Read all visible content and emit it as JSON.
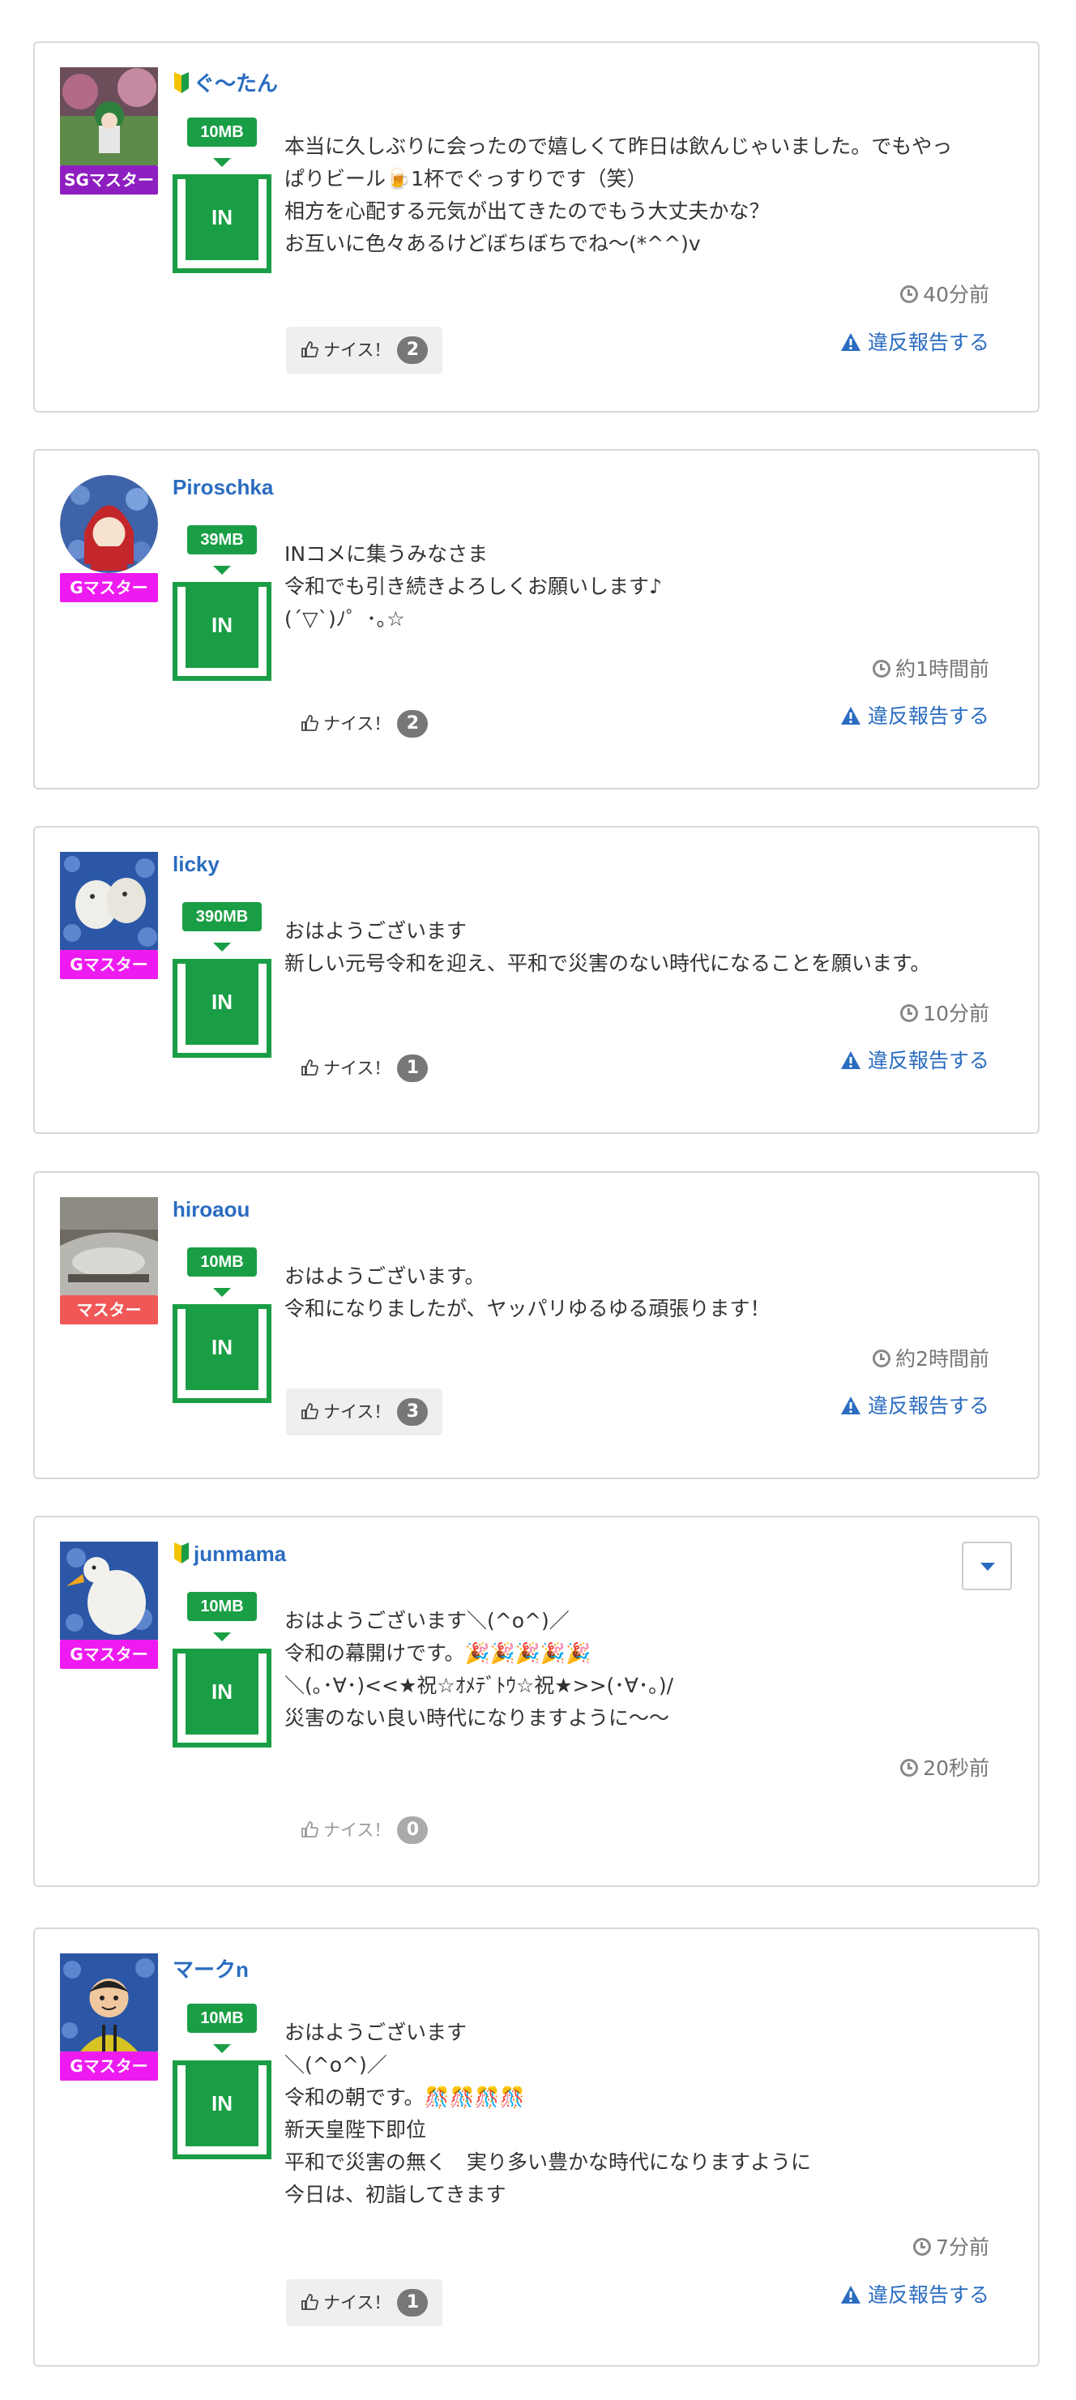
{
  "colors": {
    "accent_green": "#1a9e45",
    "link_blue": "#2a6cc0",
    "rank_sg": "#8e1ec0",
    "rank_g": "#ee1bf0",
    "rank_master": "#f05858"
  },
  "common": {
    "in_label": "IN",
    "nice_label": "ナイス！",
    "report_label": "違反報告する"
  },
  "posts": [
    {
      "username": "ぐ〜たん",
      "beginner_mark": true,
      "rank": "SGマスター",
      "mb": "10MB",
      "lines": [
        "本当に久しぶりに会ったので嬉しくて昨日は飲んじゃいました。でもやっ",
        "ぱりビール🍺1杯でぐっすりです（笑）",
        "相方を心配する元気が出てきたのでもう大丈夫かな？",
        "お互いに色々あるけどぼちぼちでね〜(*^^)v"
      ],
      "time": "40分前",
      "nice_count": "2"
    },
    {
      "username": "Piroschka",
      "beginner_mark": false,
      "rank": "Gマスター",
      "mb": "39MB",
      "lines": [
        "INコメに集うみなさま",
        "令和でも引き続きよろしくお願いします♪",
        "(´▽`)ﾉ゜･｡☆"
      ],
      "time": "約1時間前",
      "nice_count": "2"
    },
    {
      "username": "licky",
      "beginner_mark": false,
      "rank": "Gマスター",
      "mb": "390MB",
      "lines": [
        "おはようございます",
        "新しい元号令和を迎え、平和で災害のない時代になることを願います。"
      ],
      "time": "10分前",
      "nice_count": "1"
    },
    {
      "username": "hiroaou",
      "beginner_mark": false,
      "rank": "マスター",
      "mb": "10MB",
      "lines": [
        "おはようございます。",
        "令和になりましたが、ヤッパリゆるゆる頑張ります！"
      ],
      "time": "約2時間前",
      "nice_count": "3"
    },
    {
      "username": "junmama",
      "beginner_mark": true,
      "rank": "Gマスター",
      "mb": "10MB",
      "lines": [
        "おはようございます＼(^o^)／",
        "令和の幕開けです。🎉🎉🎉🎉🎉",
        "＼(｡･∀･)<<★祝☆ｵﾒﾃﾞﾄｳ☆祝★>>(･∀･｡)/",
        "災害のない良い時代になりますように〜〜"
      ],
      "time": "20秒前",
      "nice_count": "0"
    },
    {
      "username": "マークn",
      "beginner_mark": false,
      "rank": "Gマスター",
      "mb": "10MB",
      "lines": [
        "おはようございます",
        "＼(^o^)／",
        "令和の朝です。🎊🎊🎊🎊",
        "新天皇陛下即位",
        "平和で災害の無く　実り多い豊かな時代になりますように",
        "今日は、初詣してきます"
      ],
      "time": "7分前",
      "nice_count": "1"
    }
  ]
}
